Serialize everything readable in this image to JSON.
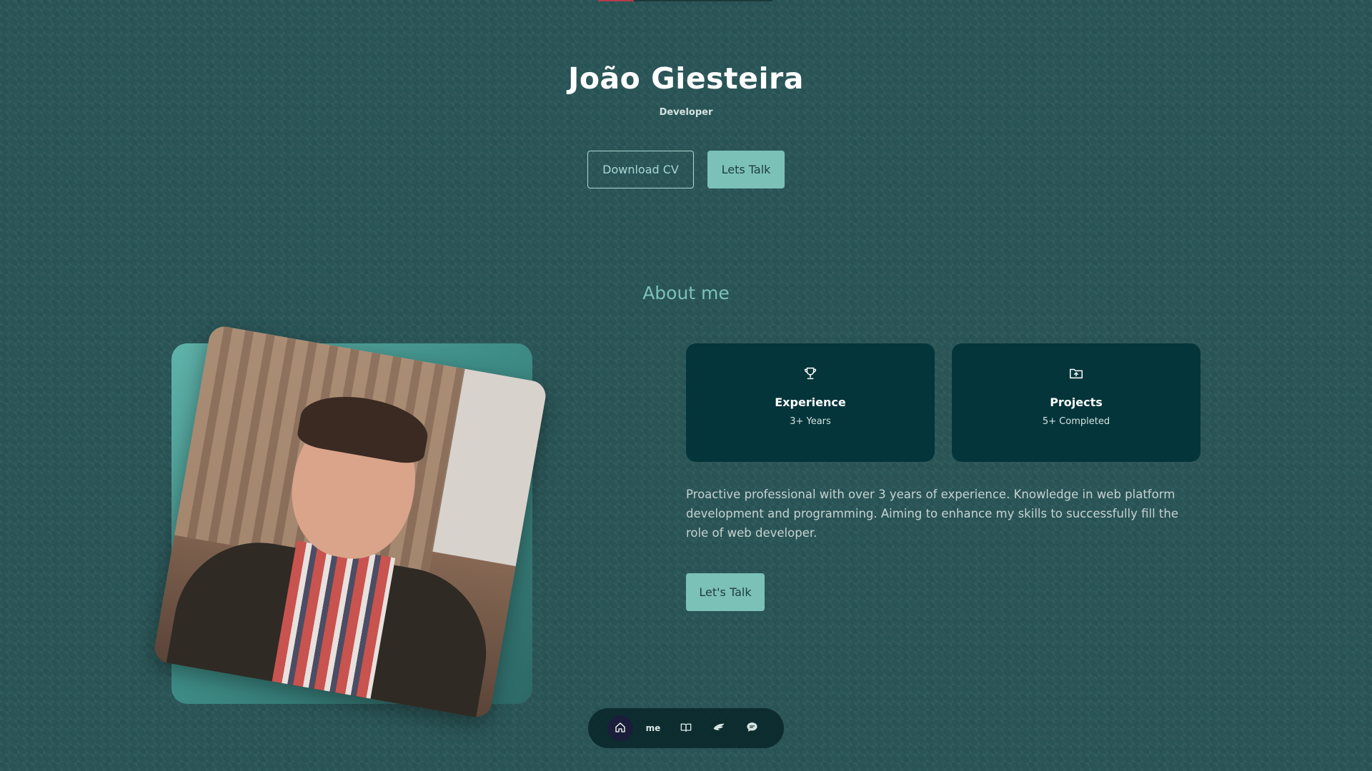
{
  "hero": {
    "name": "João Giesteira",
    "role": "Developer",
    "download_cv_label": "Download CV",
    "lets_talk_label": "Lets Talk"
  },
  "about": {
    "title": "About me",
    "cards": [
      {
        "icon": "trophy-icon",
        "title": "Experience",
        "subtitle": "3+ Years"
      },
      {
        "icon": "folder-icon",
        "title": "Projects",
        "subtitle": "5+ Completed"
      }
    ],
    "text": "Proactive professional with over 3 years of experience. Knowledge in web platform development and programming. Aiming to enhance my skills to successfully fill the role of web developer.",
    "lets_talk_label": "Let's Talk"
  },
  "nav": {
    "items": [
      {
        "icon": "home-icon",
        "active": true
      },
      {
        "label": "me",
        "active": false
      },
      {
        "icon": "book-icon",
        "active": false
      },
      {
        "icon": "wing-icon",
        "active": false
      },
      {
        "icon": "chat-icon",
        "active": false
      }
    ]
  },
  "colors": {
    "background": "#2a5557",
    "accent": "#7cc1b8",
    "card": "#04353a",
    "nav_active": "#1b1e3a",
    "progress": "#b33a4c"
  }
}
